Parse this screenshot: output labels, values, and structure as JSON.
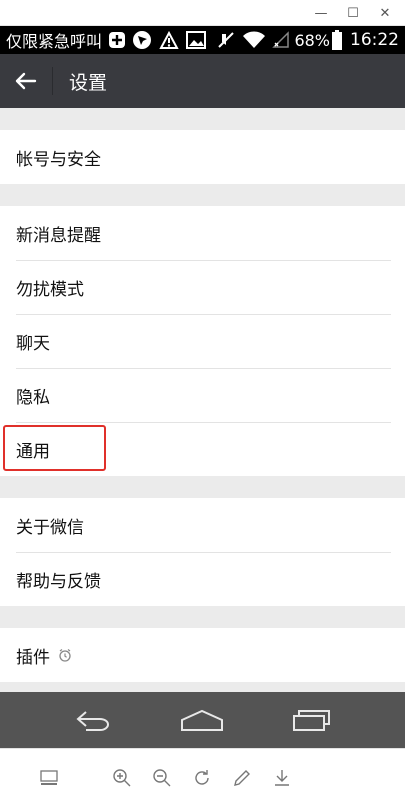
{
  "window": {
    "minimize_glyph": "—",
    "maximize_glyph": "☐",
    "close_glyph": "✕"
  },
  "status_bar": {
    "carrier": "仅限紧急呼叫",
    "battery": "68%",
    "time": "16:22",
    "icons": [
      "plus-box-icon",
      "navigation-icon",
      "alert-photo-icon",
      "image-icon",
      "mute-icon",
      "wifi-icon",
      "signal-icon",
      "battery-icon"
    ]
  },
  "app_bar": {
    "title": "设置",
    "back_icon": "back-arrow-icon"
  },
  "settings": {
    "groups": [
      {
        "items": [
          {
            "label": "帐号与安全"
          }
        ]
      },
      {
        "items": [
          {
            "label": "新消息提醒"
          },
          {
            "label": "勿扰模式"
          },
          {
            "label": "聊天"
          },
          {
            "label": "隐私"
          },
          {
            "label": "通用",
            "highlighted": true
          }
        ]
      },
      {
        "items": [
          {
            "label": "关于微信"
          },
          {
            "label": "帮助与反馈"
          }
        ]
      },
      {
        "items": [
          {
            "label": "插件",
            "icon": "plugin-status-icon"
          }
        ]
      }
    ]
  },
  "nav_bar": {
    "buttons": [
      "back-nav-icon",
      "home-nav-icon",
      "recent-apps-icon"
    ]
  },
  "toolbar": {
    "tools": [
      "layout-icon",
      "zoom-in-icon",
      "zoom-out-icon",
      "rotate-icon",
      "edit-icon",
      "download-icon"
    ]
  },
  "colors": {
    "app_bar": "#393a3f",
    "highlight_border": "#e0302a",
    "nav_bar": "#545454"
  }
}
